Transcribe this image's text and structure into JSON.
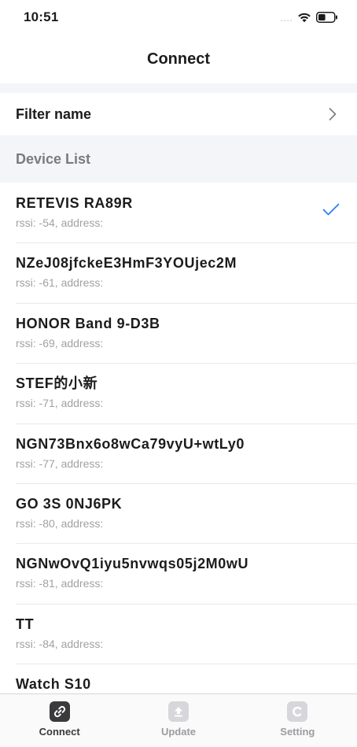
{
  "status_bar": {
    "time": "10:51",
    "signal": "....",
    "battery_level": 0.45
  },
  "nav": {
    "title": "Connect"
  },
  "filter": {
    "label": "Filter name"
  },
  "device_list": {
    "header": "Device List",
    "devices": [
      {
        "name": "RETEVIS RA89R",
        "meta": "rssi: -54, address:",
        "selected": true
      },
      {
        "name": "NZeJ08jfckeE3HmF3YOUjec2M",
        "meta": "rssi: -61, address:",
        "selected": false
      },
      {
        "name": "HONOR Band 9-D3B",
        "meta": "rssi: -69, address:",
        "selected": false
      },
      {
        "name": "STEF的小新",
        "meta": "rssi: -71, address:",
        "selected": false
      },
      {
        "name": "NGN73Bnx6o8wCa79vyU+wtLy0",
        "meta": "rssi: -77, address:",
        "selected": false
      },
      {
        "name": "GO 3S 0NJ6PK",
        "meta": "rssi: -80, address:",
        "selected": false
      },
      {
        "name": "NGNwOvQ1iyu5nvwqs05j2M0wU",
        "meta": "rssi: -81, address:",
        "selected": false
      },
      {
        "name": "TT",
        "meta": "rssi: -84, address:",
        "selected": false
      },
      {
        "name": "Watch S10",
        "meta": "",
        "selected": false
      }
    ]
  },
  "tabs": [
    {
      "label": "Connect",
      "icon": "link-icon",
      "active": true
    },
    {
      "label": "Update",
      "icon": "upload-icon",
      "active": false
    },
    {
      "label": "Setting",
      "icon": "c-logo-icon",
      "active": false
    }
  ],
  "colors": {
    "accent": "#2f7cf6",
    "section_bg": "#f3f5f9",
    "active_tab": "#3a3a3c",
    "inactive_tab": "#9c9ca0"
  }
}
